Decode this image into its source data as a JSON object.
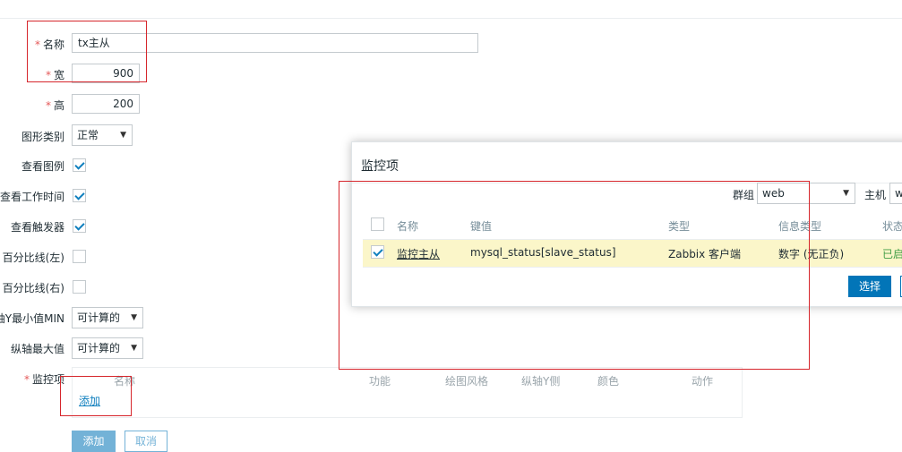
{
  "form": {
    "name_label": "名称",
    "name_value": "tx主从",
    "width_label": "宽",
    "width_value": "900",
    "height_label": "高",
    "height_value": "200",
    "graph_type_label": "图形类别",
    "graph_type_value": "正常",
    "show_legend_label": "查看图例",
    "show_working_time_label": "查看工作时间",
    "show_triggers_label": "查看触发器",
    "percentile_left_label": "百分比线(左)",
    "percentile_right_label": "百分比线(右)",
    "ymin_label": "轴Y最小值MIN",
    "ymin_value": "可计算的",
    "ymax_label": "纵轴最大值",
    "ymax_value": "可计算的",
    "items_label": "监控项",
    "items_columns": [
      "名称",
      "功能",
      "绘图风格",
      "纵轴Y侧",
      "颜色",
      "动作"
    ],
    "add_link": "添加",
    "add_button": "添加",
    "cancel_button": "取消"
  },
  "dialog": {
    "title": "监控项",
    "group_label": "群组",
    "group_value": "web",
    "host_label": "主机",
    "host_value": "w",
    "columns": [
      "名称",
      "键值",
      "类型",
      "信息类型",
      "状态"
    ],
    "rows": [
      {
        "name": "监控主从",
        "key": "mysql_status[slave_status]",
        "type": "Zabbix 客户端",
        "info_type": "数字 (无正负)",
        "status": "已启"
      }
    ],
    "select_button": "选择"
  },
  "colors": {
    "accent": "#0275b8",
    "required": "#e45959",
    "annotation": "#d6262c",
    "row_highlight": "#fbf6c9",
    "enabled_status": "#429e47"
  }
}
